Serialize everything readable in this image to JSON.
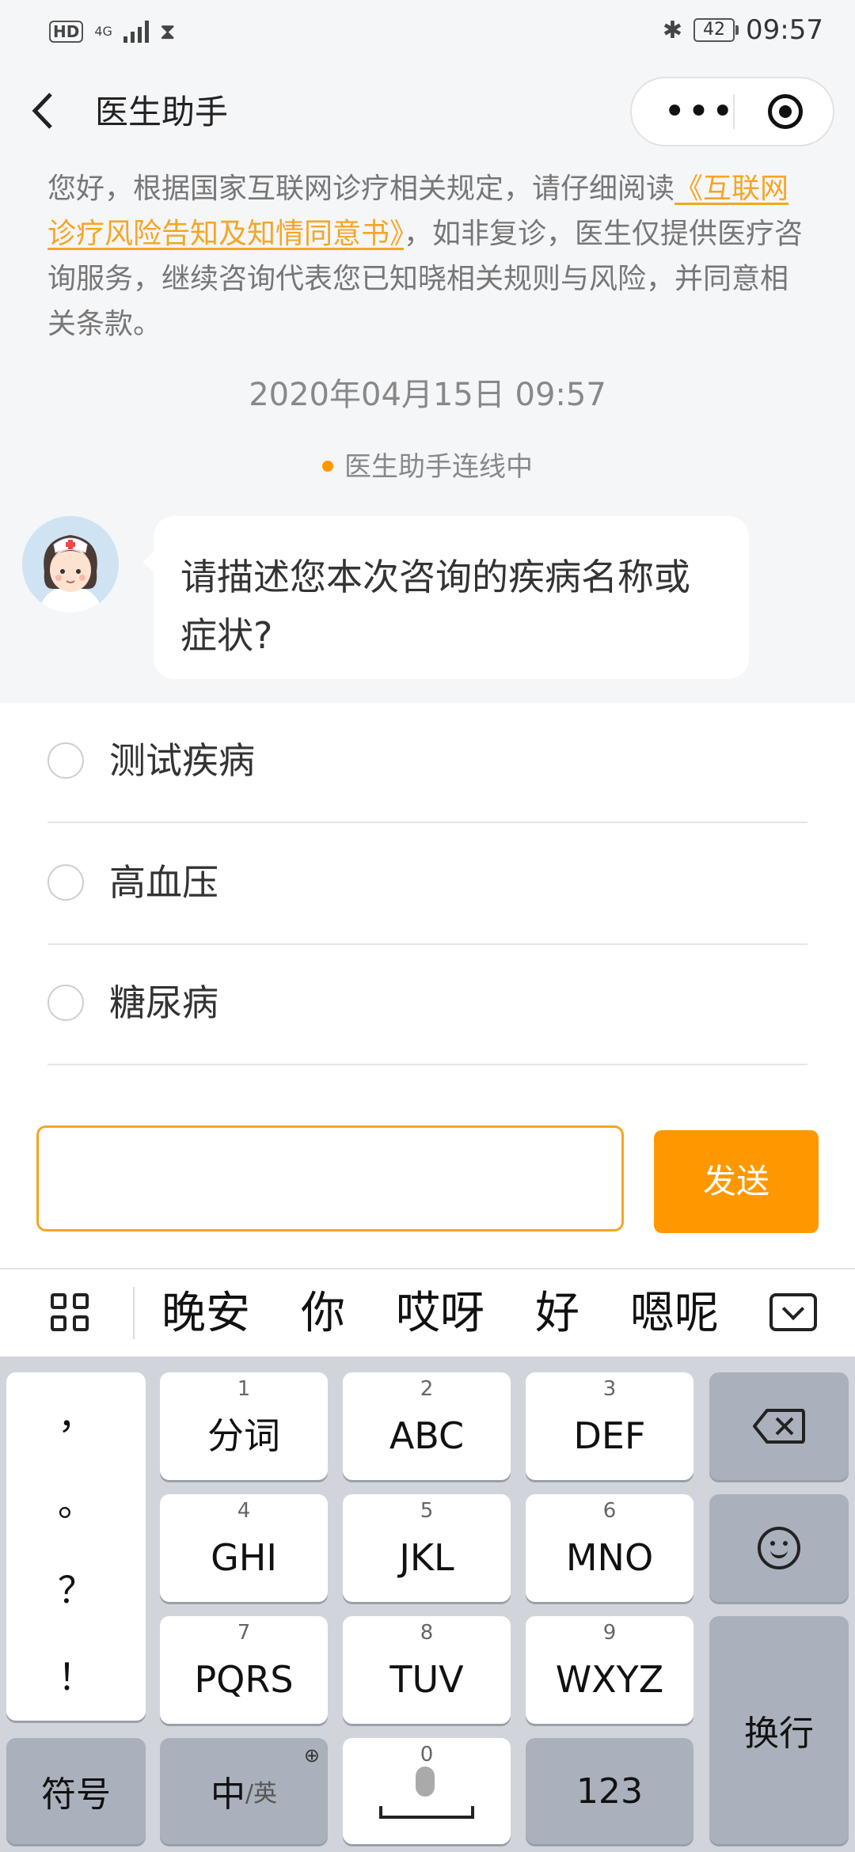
{
  "status_bar": {
    "hd": "HD",
    "network": "4G",
    "battery": "42",
    "time": "09:57"
  },
  "header": {
    "back_icon": "chevron-left-icon",
    "title": "医生助手",
    "more_icon": "•••",
    "close_icon": "target-icon"
  },
  "chat": {
    "notice_pre": "您好，根据国家互联网诊疗相关规定，请仔细阅读",
    "notice_link": "《互联网诊疗风险告知及知情同意书》",
    "notice_post": "，如非复诊，医生仅提供医疗咨询服务，继续咨询代表您已知晓相关规则与风险，并同意相关条款。",
    "timestamp": "2020年04月15日 09:57",
    "connection_status": "医生助手连线中",
    "message": "请描述您本次咨询的疾病名称或症状?"
  },
  "options": [
    {
      "label": "测试疾病"
    },
    {
      "label": "高血压"
    },
    {
      "label": "糖尿病"
    }
  ],
  "composer": {
    "input_value": "",
    "send_label": "发送"
  },
  "keyboard": {
    "candidates": [
      "晚安",
      "你",
      "哎呀",
      "好",
      "嗯呢"
    ],
    "punctuation": [
      "，",
      "。",
      "？",
      "！"
    ],
    "keys": [
      {
        "num": "1",
        "label": "分词"
      },
      {
        "num": "2",
        "label": "ABC"
      },
      {
        "num": "3",
        "label": "DEF"
      },
      {
        "num": "4",
        "label": "GHI"
      },
      {
        "num": "5",
        "label": "JKL"
      },
      {
        "num": "6",
        "label": "MNO"
      },
      {
        "num": "7",
        "label": "PQRS"
      },
      {
        "num": "8",
        "label": "TUV"
      },
      {
        "num": "9",
        "label": "WXYZ"
      }
    ],
    "symbols_label": "符号",
    "lang_main": "中",
    "lang_sub": "/英",
    "space_num": "0",
    "numbers_label": "123",
    "enter_label": "换行"
  },
  "colors": {
    "accent": "#ff9800",
    "link": "#f5a623",
    "background": "#f5f6f8"
  }
}
